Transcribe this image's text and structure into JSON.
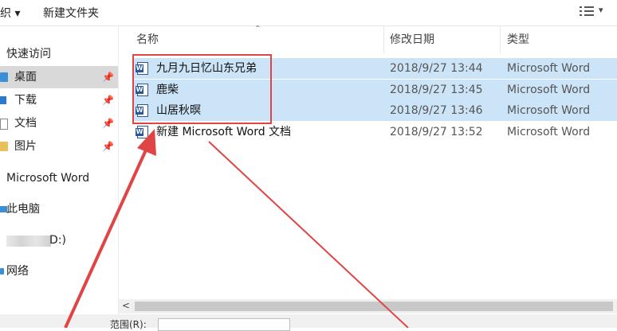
{
  "toolbar": {
    "organize_label": "织 ▾",
    "new_folder_label": "新建文件夹",
    "view_caret": "▾"
  },
  "sidebar": {
    "quick_access": "快速访问",
    "items": [
      {
        "label": "桌面",
        "icon": "desktop-folder-icon",
        "pinned": true,
        "selected": true
      },
      {
        "label": "下载",
        "icon": "download-icon",
        "pinned": true,
        "selected": false
      },
      {
        "label": "文档",
        "icon": "document-icon",
        "pinned": true,
        "selected": false
      },
      {
        "label": "图片",
        "icon": "pictures-folder-icon",
        "pinned": true,
        "selected": false
      }
    ],
    "word": "Microsoft Word",
    "this_pc": "此电脑",
    "drive_label": "D:)",
    "network": "网络",
    "pin_glyph": "📌"
  },
  "columns": {
    "name": "名称",
    "modified": "修改日期",
    "type": "类型",
    "sort_glyph": "⌃"
  },
  "files": [
    {
      "name": "九月九日忆山东兄弟",
      "date": "2018/9/27 13:44",
      "type": "Microsoft Word",
      "selected": true
    },
    {
      "name": "鹿柴",
      "date": "2018/9/27 13:45",
      "type": "Microsoft Word",
      "selected": true
    },
    {
      "name": "山居秋暝",
      "date": "2018/9/27 13:46",
      "type": "Microsoft Word",
      "selected": true
    },
    {
      "name": "新建 Microsoft Word 文档",
      "date": "2018/9/27 13:52",
      "type": "Microsoft Word",
      "selected": false
    }
  ],
  "scrollbar": {
    "left_arrow": "<"
  },
  "bottom": {
    "range_label": "范围(R):"
  },
  "colors": {
    "selection": "#cce4f7",
    "annotation": "#e04444",
    "sidebar_selected": "#d9d9d9"
  }
}
